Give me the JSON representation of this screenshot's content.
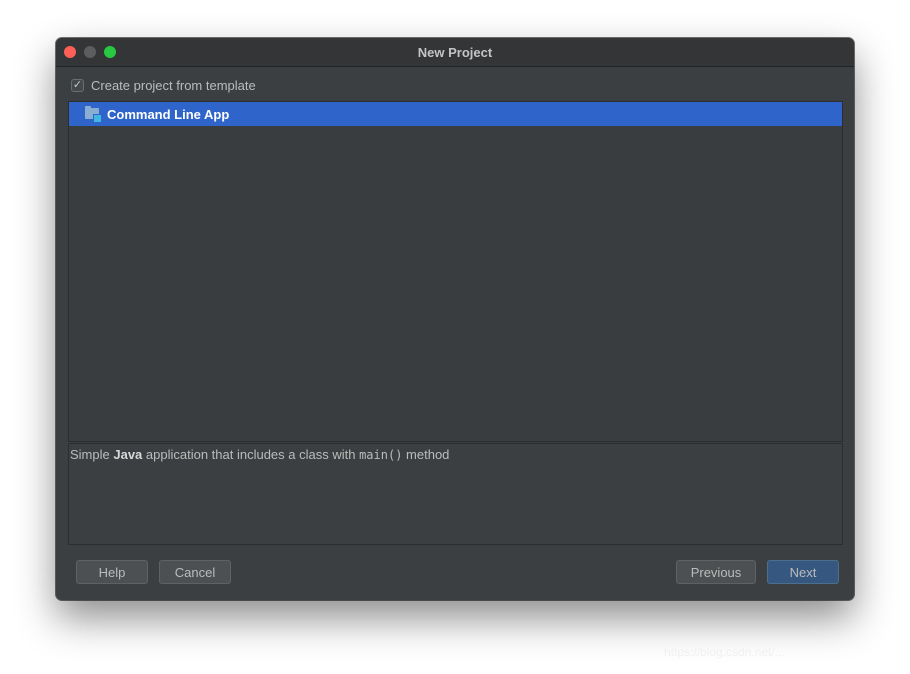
{
  "window": {
    "title": "New Project"
  },
  "template_option": {
    "checkbox_checked": true,
    "checkbox_mark": "✓",
    "label": "Create project from template"
  },
  "template_list": {
    "items": [
      {
        "label": "Command Line App",
        "icon": "folder-module-icon",
        "selected": true
      }
    ]
  },
  "description": {
    "prefix": "Simple ",
    "language": "Java",
    "middle": " application that includes a class with ",
    "code": "main()",
    "suffix": " method"
  },
  "buttons": {
    "help": "Help",
    "cancel": "Cancel",
    "previous": "Previous",
    "next": "Next"
  },
  "watermark": "https://blog.csdn.net/..."
}
